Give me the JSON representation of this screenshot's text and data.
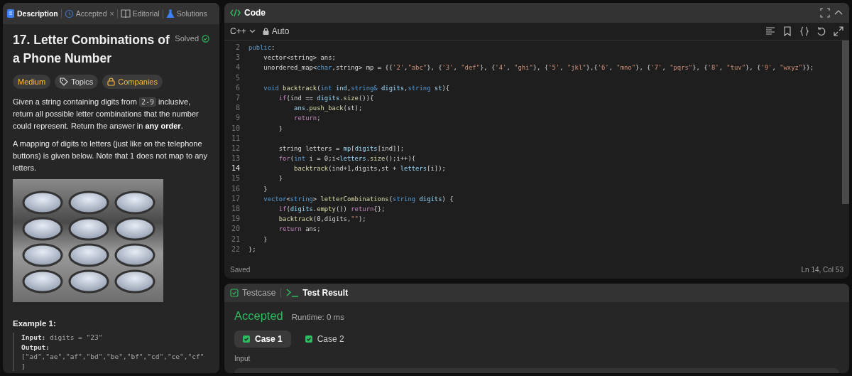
{
  "problem_panel": {
    "tabs": [
      {
        "label": "Description",
        "selected": true
      },
      {
        "label": "Accepted",
        "close": "×",
        "selected": false
      },
      {
        "label": "Editorial",
        "selected": false
      },
      {
        "label": "Solutions",
        "selected": false
      }
    ],
    "title": "17. Letter Combinations of a Phone Number",
    "status": "Solved",
    "tags": [
      {
        "label": "Medium",
        "kind": "difficulty"
      },
      {
        "label": "Topics",
        "kind": "topics"
      },
      {
        "label": "Companies",
        "kind": "companies"
      }
    ],
    "paragraphs": [
      {
        "before": "Given a string containing digits from ",
        "code": "2-9",
        "after": " inclusive, return all possible letter combinations that the number could represent. Return the answer in **any order**."
      },
      {
        "before": "A mapping of digits to letters (just like on the telephone buttons) is given below. Note that 1 does not map to any letters."
      }
    ],
    "example": {
      "title": "Example 1:",
      "input_label": "Input:",
      "input_value": "digits = \"23\"",
      "output_label": "Output:",
      "output_lines": [
        "[\"ad\",\"ae\",\"af\",\"bd\",\"be\",\"bf\",\"cd\",\"ce\",\"cf\"",
        "]"
      ]
    }
  },
  "code_panel": {
    "title": "Code",
    "language": "C++",
    "mode": "Auto",
    "status": "Saved",
    "cursor": "Ln 14, Col 53",
    "lines": [
      {
        "number": "2",
        "active": false,
        "segments": [
          {
            "text": "public",
            "kind": "type"
          },
          {
            "text": ":",
            "kind": "plain"
          }
        ]
      },
      {
        "number": "3",
        "active": false,
        "segments": [
          {
            "text": "    vector<string> ans;",
            "kind": "plain"
          }
        ]
      },
      {
        "number": "4",
        "active": false,
        "segments": [
          {
            "text": "    unordered_map<",
            "kind": "plain"
          },
          {
            "text": "char",
            "kind": "type"
          },
          {
            "text": ",string> mp = {{",
            "kind": "plain"
          },
          {
            "text": "'2'",
            "kind": "string"
          },
          {
            "text": ",",
            "kind": "plain"
          },
          {
            "text": "\"abc\"",
            "kind": "string"
          },
          {
            "text": "}, {",
            "kind": "plain"
          },
          {
            "text": "'3'",
            "kind": "string"
          },
          {
            "text": ", ",
            "kind": "plain"
          },
          {
            "text": "\"def\"",
            "kind": "string"
          },
          {
            "text": "}, {",
            "kind": "plain"
          },
          {
            "text": "'4'",
            "kind": "string"
          },
          {
            "text": ", ",
            "kind": "plain"
          },
          {
            "text": "\"ghi\"",
            "kind": "string"
          },
          {
            "text": "}, {",
            "kind": "plain"
          },
          {
            "text": "'5'",
            "kind": "string"
          },
          {
            "text": ", ",
            "kind": "plain"
          },
          {
            "text": "\"jkl\"",
            "kind": "string"
          },
          {
            "text": "},{",
            "kind": "plain"
          },
          {
            "text": "'6'",
            "kind": "string"
          },
          {
            "text": ", ",
            "kind": "plain"
          },
          {
            "text": "\"mno\"",
            "kind": "string"
          },
          {
            "text": "}, {",
            "kind": "plain"
          },
          {
            "text": "'7'",
            "kind": "string"
          },
          {
            "text": ", ",
            "kind": "plain"
          },
          {
            "text": "\"pqrs\"",
            "kind": "string"
          },
          {
            "text": "}, {",
            "kind": "plain"
          },
          {
            "text": "'8'",
            "kind": "string"
          },
          {
            "text": ", ",
            "kind": "plain"
          },
          {
            "text": "\"tuv\"",
            "kind": "string"
          },
          {
            "text": "}, {",
            "kind": "plain"
          },
          {
            "text": "'9'",
            "kind": "string"
          },
          {
            "text": ", ",
            "kind": "plain"
          },
          {
            "text": "\"wxyz\"",
            "kind": "string"
          },
          {
            "text": "}};",
            "kind": "plain"
          }
        ]
      },
      {
        "number": "5",
        "active": false
      },
      {
        "number": "6",
        "active": false,
        "segments": [
          {
            "text": "    void ",
            "kind": "type"
          },
          {
            "text": "backtrack",
            "kind": "function"
          },
          {
            "text": "(",
            "kind": "plain"
          },
          {
            "text": "int ",
            "kind": "type"
          },
          {
            "text": "ind",
            "kind": "variable"
          },
          {
            "text": ",",
            "kind": "plain"
          },
          {
            "text": "string& ",
            "kind": "type"
          },
          {
            "text": "digits",
            "kind": "variable"
          },
          {
            "text": ",",
            "kind": "plain"
          },
          {
            "text": "string ",
            "kind": "type"
          },
          {
            "text": "st",
            "kind": "variable"
          },
          {
            "text": "){",
            "kind": "plain"
          }
        ]
      },
      {
        "number": "7",
        "active": false,
        "segments": [
          {
            "text": "        if",
            "kind": "keyword"
          },
          {
            "text": "(ind == ",
            "kind": "plain"
          },
          {
            "text": "digits",
            "kind": "variable"
          },
          {
            "text": ".",
            "kind": "plain"
          },
          {
            "text": "size",
            "kind": "function"
          },
          {
            "text": "()){",
            "kind": "plain"
          }
        ]
      },
      {
        "number": "8",
        "active": false,
        "segments": [
          {
            "text": "            ans",
            "kind": "variable"
          },
          {
            "text": ".",
            "kind": "plain"
          },
          {
            "text": "push_back",
            "kind": "function"
          },
          {
            "text": "(st);",
            "kind": "plain"
          }
        ]
      },
      {
        "number": "9",
        "active": false,
        "segments": [
          {
            "text": "            return",
            "kind": "keyword"
          },
          {
            "text": ";",
            "kind": "plain"
          }
        ]
      },
      {
        "number": "10",
        "active": false,
        "segments": [
          {
            "text": "        }",
            "kind": "plain"
          }
        ]
      },
      {
        "number": "11",
        "active": false
      },
      {
        "number": "12",
        "active": false,
        "segments": [
          {
            "text": "        string letters = ",
            "kind": "plain"
          },
          {
            "text": "mp",
            "kind": "variable"
          },
          {
            "text": "[",
            "kind": "plain"
          },
          {
            "text": "digits",
            "kind": "variable"
          },
          {
            "text": "[ind]];",
            "kind": "plain"
          }
        ]
      },
      {
        "number": "13",
        "active": false,
        "segments": [
          {
            "text": "        for",
            "kind": "keyword"
          },
          {
            "text": "(",
            "kind": "plain"
          },
          {
            "text": "int",
            "kind": "type"
          },
          {
            "text": " i = 0;i<",
            "kind": "plain"
          },
          {
            "text": "letters",
            "kind": "variable"
          },
          {
            "text": ".",
            "kind": "plain"
          },
          {
            "text": "size",
            "kind": "function"
          },
          {
            "text": "();i++){",
            "kind": "plain"
          }
        ]
      },
      {
        "number": "14",
        "active": true,
        "segments": [
          {
            "text": "            backtrack",
            "kind": "function"
          },
          {
            "text": "(ind+1,digits,st + ",
            "kind": "plain"
          },
          {
            "text": "letters",
            "kind": "variable"
          },
          {
            "text": "[i]);",
            "kind": "plain"
          }
        ]
      },
      {
        "number": "15",
        "active": false,
        "segments": [
          {
            "text": "        }",
            "kind": "plain"
          }
        ]
      },
      {
        "number": "16",
        "active": false,
        "segments": [
          {
            "text": "    }",
            "kind": "plain"
          }
        ]
      },
      {
        "number": "17",
        "active": false,
        "segments": [
          {
            "text": "    vector",
            "kind": "type"
          },
          {
            "text": "<",
            "kind": "plain"
          },
          {
            "text": "string",
            "kind": "type"
          },
          {
            "text": "> ",
            "kind": "plain"
          },
          {
            "text": "letterCombinations",
            "kind": "function"
          },
          {
            "text": "(",
            "kind": "plain"
          },
          {
            "text": "string ",
            "kind": "type"
          },
          {
            "text": "digits",
            "kind": "variable"
          },
          {
            "text": ") {",
            "kind": "plain"
          }
        ]
      },
      {
        "number": "18",
        "active": false,
        "segments": [
          {
            "text": "        if",
            "kind": "keyword"
          },
          {
            "text": "(",
            "kind": "plain"
          },
          {
            "text": "digits",
            "kind": "variable"
          },
          {
            "text": ".",
            "kind": "plain"
          },
          {
            "text": "empty",
            "kind": "function"
          },
          {
            "text": "()) ",
            "kind": "plain"
          },
          {
            "text": "return",
            "kind": "keyword"
          },
          {
            "text": "{};",
            "kind": "plain"
          }
        ]
      },
      {
        "number": "19",
        "active": false,
        "segments": [
          {
            "text": "        backtrack",
            "kind": "function"
          },
          {
            "text": "(0,digits,",
            "kind": "plain"
          },
          {
            "text": "\"\"",
            "kind": "string"
          },
          {
            "text": ");",
            "kind": "plain"
          }
        ]
      },
      {
        "number": "20",
        "active": false,
        "segments": [
          {
            "text": "        return",
            "kind": "keyword"
          },
          {
            "text": " ans;",
            "kind": "plain"
          }
        ]
      },
      {
        "number": "21",
        "active": false,
        "segments": [
          {
            "text": "    }",
            "kind": "plain"
          }
        ]
      },
      {
        "number": "22",
        "active": false,
        "segments": [
          {
            "text": "};",
            "kind": "plain"
          }
        ]
      }
    ]
  },
  "result_panel": {
    "tabs": [
      {
        "label": "Testcase",
        "selected": false
      },
      {
        "label": "Test Result",
        "selected": true
      }
    ],
    "verdict": "Accepted",
    "runtime": "Runtime: 0 ms",
    "cases": [
      {
        "label": "Case 1",
        "selected": true
      },
      {
        "label": "Case 2",
        "selected": false
      }
    ],
    "input_label": "Input"
  }
}
